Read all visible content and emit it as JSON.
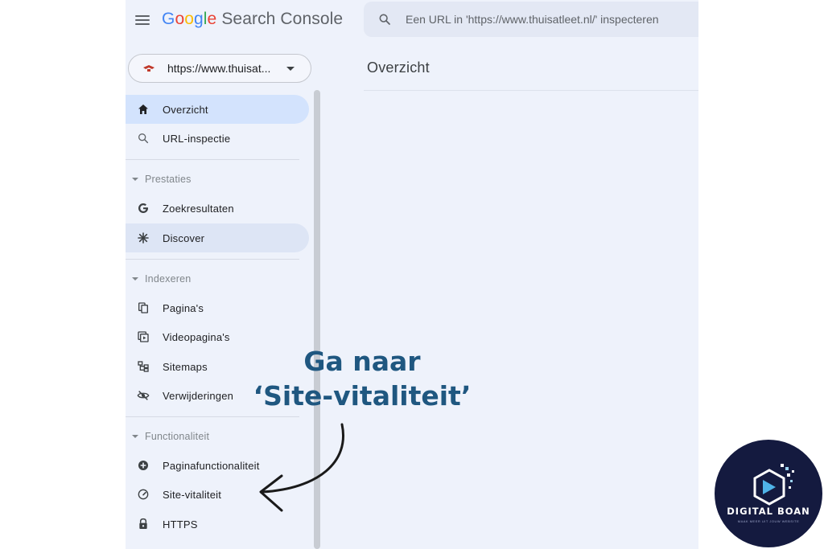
{
  "header": {
    "logo_google": [
      "G",
      "o",
      "o",
      "g",
      "l",
      "e"
    ],
    "logo_colors": [
      "#4285f4",
      "#ea4335",
      "#fbbc05",
      "#4285f4",
      "#34a853",
      "#ea4335"
    ],
    "logo_product": "Search Console",
    "search_placeholder": "Een URL in 'https://www.thuisatleet.nl/' inspecteren"
  },
  "property": {
    "url": "https://www.thuisat..."
  },
  "sidebar": {
    "top_items": [
      {
        "label": "Overzicht",
        "icon": "home-icon",
        "active": true
      },
      {
        "label": "URL-inspectie",
        "icon": "search-icon"
      }
    ],
    "sections": [
      {
        "title": "Prestaties",
        "items": [
          {
            "label": "Zoekresultaten",
            "icon": "google-g-icon"
          },
          {
            "label": "Discover",
            "icon": "asterisk-icon",
            "highlighted": true
          }
        ]
      },
      {
        "title": "Indexeren",
        "items": [
          {
            "label": "Pagina's",
            "icon": "pages-icon"
          },
          {
            "label": "Videopagina's",
            "icon": "video-pages-icon"
          },
          {
            "label": "Sitemaps",
            "icon": "sitemap-icon"
          },
          {
            "label": "Verwijderingen",
            "icon": "eye-off-icon"
          }
        ]
      },
      {
        "title": "Functionaliteit",
        "items": [
          {
            "label": "Paginafunctionaliteit",
            "icon": "add-circle-icon"
          },
          {
            "label": "Site-vitaliteit",
            "icon": "speedometer-icon"
          },
          {
            "label": "HTTPS",
            "icon": "lock-icon"
          }
        ]
      }
    ]
  },
  "main": {
    "title": "Overzicht"
  },
  "annotation": {
    "line1": "Ga naar",
    "line2": "‘Site-vitaliteit’",
    "color": "#1f5780"
  },
  "badge": {
    "brand": "DIGITAL BOAN",
    "tagline": "MAAK MEER UIT JOUW WEBSITE"
  },
  "colors": {
    "background": "#eef2fb",
    "active_item": "#d3e3fd",
    "badge_bg": "#141a3f"
  }
}
